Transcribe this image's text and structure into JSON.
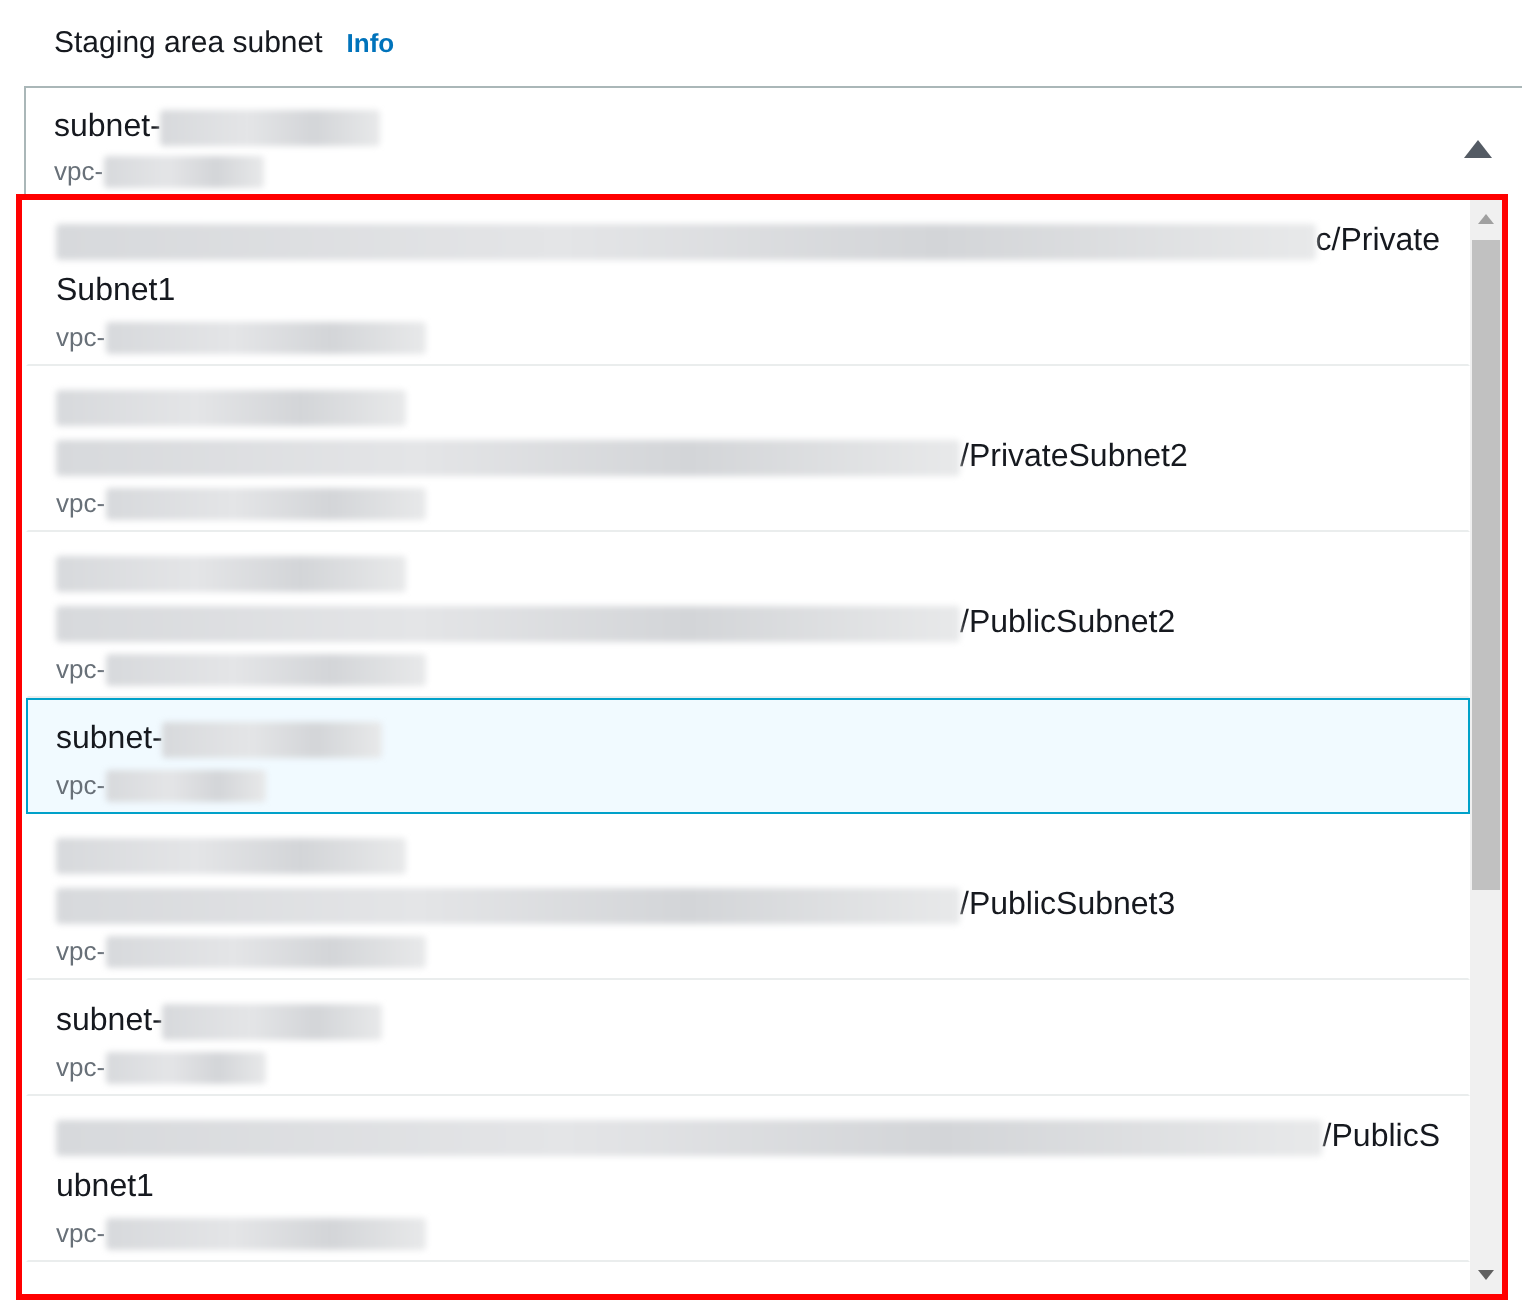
{
  "field": {
    "label": "Staging area subnet",
    "info_link": "Info"
  },
  "select": {
    "expanded": true,
    "name": {
      "text": "subnet-",
      "redacted_before": false,
      "redacted_after": true
    },
    "vpc": {
      "text": "vpc-",
      "redacted_before": false,
      "redacted_after": true
    }
  },
  "options": [
    {
      "selected": false,
      "name_lines": [
        {
          "text": "c/Private",
          "redacted_before": true,
          "redacted_after": false
        },
        {
          "text": "Subnet1",
          "redacted_before": false,
          "redacted_after": false
        }
      ],
      "vpc": {
        "text": "vpc-",
        "redacted_before": false,
        "redacted_after": true
      }
    },
    {
      "selected": false,
      "name_lines": [
        {
          "redacted_before": true,
          "redacted_after": false
        },
        {
          "text": "/PrivateSubnet2",
          "redacted_before": true,
          "redacted_after": false
        }
      ],
      "vpc": {
        "text": "vpc-",
        "redacted_before": false,
        "redacted_after": true
      }
    },
    {
      "selected": false,
      "name_lines": [
        {
          "redacted_before": true,
          "redacted_after": false
        },
        {
          "text": "/PublicSubnet2",
          "redacted_before": true,
          "redacted_after": false
        }
      ],
      "vpc": {
        "text": "vpc-",
        "redacted_before": false,
        "redacted_after": true
      }
    },
    {
      "selected": true,
      "name_lines": [
        {
          "text": "subnet-",
          "redacted_before": false,
          "redacted_after": true
        }
      ],
      "vpc": {
        "text": "vpc-",
        "redacted_before": false,
        "redacted_after": true
      }
    },
    {
      "selected": false,
      "name_lines": [
        {
          "redacted_before": true,
          "redacted_after": false
        },
        {
          "text": "/PublicSubnet3",
          "redacted_before": true,
          "redacted_after": false
        }
      ],
      "vpc": {
        "text": "vpc-",
        "redacted_before": false,
        "redacted_after": true
      }
    },
    {
      "selected": false,
      "name_lines": [
        {
          "text": "subnet-",
          "redacted_before": false,
          "redacted_after": true
        }
      ],
      "vpc": {
        "text": "vpc-",
        "redacted_before": false,
        "redacted_after": true
      }
    },
    {
      "selected": false,
      "name_lines": [
        {
          "text": "/PublicS",
          "redacted_before": true,
          "redacted_after": false
        },
        {
          "text": "ubnet1",
          "redacted_before": false,
          "redacted_after": false
        }
      ],
      "vpc": {
        "text": "vpc-",
        "redacted_before": false,
        "redacted_after": true
      }
    }
  ]
}
